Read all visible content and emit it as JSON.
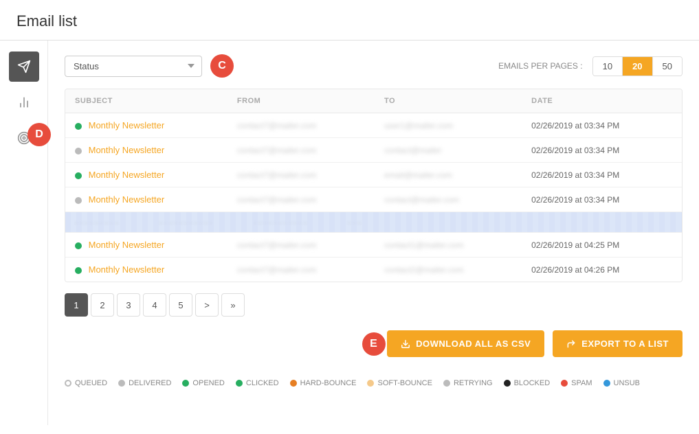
{
  "header": {
    "title": "Email list"
  },
  "toolbar": {
    "status_placeholder": "Status",
    "badge_c": "C",
    "badge_d": "D",
    "badge_e": "E",
    "emails_per_page_label": "EMAILS PER PAGES :",
    "per_page_options": [
      {
        "label": "10",
        "active": false
      },
      {
        "label": "20",
        "active": true
      },
      {
        "label": "50",
        "active": false
      }
    ]
  },
  "table": {
    "columns": [
      "SUBJECT",
      "FROM",
      "TO",
      "DATE"
    ],
    "rows": [
      {
        "status": "green",
        "subject": "Monthly Newsletter",
        "from": "contact@mailer.com",
        "to": "user1@mailer.com",
        "date": "02/26/2019 at 03:34 PM",
        "highlighted": false
      },
      {
        "status": "gray",
        "subject": "Monthly Newsletter",
        "from": "contact@mailer.com",
        "to": "contact@mailer",
        "date": "02/26/2019 at 03:34 PM",
        "highlighted": false
      },
      {
        "status": "green",
        "subject": "Monthly Newsletter",
        "from": "contact@mailer.com",
        "to": "email@mailer.com",
        "date": "02/26/2019 at 03:34 PM",
        "highlighted": false
      },
      {
        "status": "gray",
        "subject": "Monthly Newsletter",
        "from": "contact@mailer.com",
        "to": "contact@mailer.com",
        "date": "02/26/2019 at 03:34 PM",
        "highlighted": false
      }
    ],
    "wavy_row": true,
    "rows_after": [
      {
        "status": "green",
        "subject": "Monthly Newsletter",
        "from": "contact@mailer.com",
        "to": "contact1@mailer.com",
        "date": "02/26/2019 at 04:25 PM",
        "highlighted": false
      },
      {
        "status": "green",
        "subject": "Monthly Newsletter",
        "from": "contact@mailer.com",
        "to": "contact2@mailer.com",
        "date": "02/26/2019 at 04:26 PM",
        "highlighted": false
      }
    ]
  },
  "pagination": {
    "pages": [
      "1",
      "2",
      "3",
      "4",
      "5",
      ">",
      "»"
    ],
    "active": "1"
  },
  "actions": {
    "download_label": "DOWNLOAD ALL AS CSV",
    "export_label": "EXPORT TO A LIST"
  },
  "legend": [
    {
      "label": "QUEUED",
      "type": "circle",
      "color": "#bbb"
    },
    {
      "label": "DELIVERED",
      "type": "dot",
      "color": "#bbb"
    },
    {
      "label": "OPENED",
      "type": "dot",
      "color": "#27ae60"
    },
    {
      "label": "CLICKED",
      "type": "dot",
      "color": "#27ae60"
    },
    {
      "label": "HARD-BOUNCE",
      "type": "dot",
      "color": "#e67e22"
    },
    {
      "label": "SOFT-BOUNCE",
      "type": "dot",
      "color": "#f5a623"
    },
    {
      "label": "RETRYING",
      "type": "dot",
      "color": "#bbb"
    },
    {
      "label": "BLOCKED",
      "type": "dot",
      "color": "#222"
    },
    {
      "label": "SPAM",
      "type": "dot",
      "color": "#e74c3c"
    },
    {
      "label": "UNSUB",
      "type": "dot",
      "color": "#3498db"
    }
  ],
  "sidebar": {
    "items": [
      {
        "icon": "send",
        "label": "Send"
      },
      {
        "icon": "chart",
        "label": "Analytics"
      },
      {
        "icon": "target",
        "label": "Campaigns"
      }
    ]
  }
}
